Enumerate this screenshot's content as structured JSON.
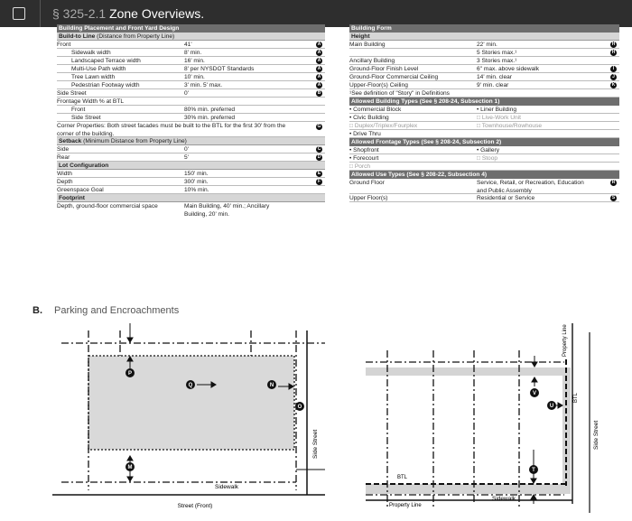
{
  "header": {
    "section": "§ 325-2.1",
    "title": "Zone Overviews."
  },
  "left": {
    "title": "Building Placement and Front Yard Design",
    "btl_head": "Build-to Line",
    "btl_note": "(Distance from Property Line)",
    "front": {
      "label": "Front",
      "value": "41'",
      "badge": "A"
    },
    "front_rows": [
      {
        "label": "Sidewalk width",
        "value": "8' min.",
        "badge": "A"
      },
      {
        "label": "Landscaped Terrace width",
        "value": "16' min.",
        "badge": "A"
      },
      {
        "label": "Multi-Use Path width",
        "value": "8' per NYSDOT Standards",
        "badge": "A"
      },
      {
        "label": "Tree Lawn width",
        "value": "10' min.",
        "badge": "A"
      },
      {
        "label": "Pedestrian Footway width",
        "value": "3' min. 5' max.",
        "badge": "A"
      }
    ],
    "side_street": {
      "label": "Side Street",
      "value": "0'",
      "badge": "B"
    },
    "frontage": {
      "label": "Frontage Width % at BTL"
    },
    "frontage_front": {
      "label": "Front",
      "value": "80% min. preferred"
    },
    "frontage_side": {
      "label": "Side Street",
      "value": "30% min. preferred"
    },
    "corner": {
      "text": "Corner Properties: Both street facades must be built to the BTL for the first 30' from the corner of the building.",
      "badge": "G"
    },
    "setback_head": "Setback",
    "setback_note": "(Minimum Distance from Property Line)",
    "side": {
      "label": "Side",
      "value": "0'",
      "badge": "C"
    },
    "rear": {
      "label": "Rear",
      "value": "5'",
      "badge": "D"
    },
    "lot_head": "Lot Configuration",
    "width": {
      "label": "Width",
      "value": "150' min.",
      "badge": "E"
    },
    "depth": {
      "label": "Depth",
      "value": "300' min.",
      "badge": "F"
    },
    "green": {
      "label": "Greenspace Goal",
      "value": "10% min."
    },
    "foot_head": "Footprint",
    "foot": {
      "label": "Depth, ground-floor commercial space",
      "value": "Main Building, 40' min.; Ancillary Building, 20' min."
    }
  },
  "right": {
    "title": "Building Form",
    "height_head": "Height",
    "main_building": {
      "label": "Main Building",
      "value": "22' min.",
      "badge": "H"
    },
    "main_building2": {
      "value": "5 Stories max.¹",
      "badge": "H"
    },
    "ancillary": {
      "label": "Ancillary Building",
      "value": "3 Stories max.¹"
    },
    "gf_finish": {
      "label": "Ground-Floor Finish Level",
      "value": "6\" max. above sidewalk",
      "badge": "I"
    },
    "gf_ceiling": {
      "label": "Ground-Floor Commercial Ceiling",
      "value": "14' min. clear",
      "badge": "J"
    },
    "uf_ceiling": {
      "label": "Upper-Floor(s) Ceiling",
      "value": "9' min. clear",
      "badge": "K"
    },
    "footnote": "¹See definition of \"Story\" in Definitions",
    "types_head": "Allowed Building Types (See § 208-24, Subsection 1)",
    "types": [
      [
        "• Commercial Block",
        "• Liner Building"
      ],
      [
        "• Civic Building",
        "□ Live-Work Unit"
      ],
      [
        "□ Duplex/Triplex/Fourplex",
        "□ Townhouse/Rowhouse"
      ],
      [
        "• Drive Thru",
        ""
      ]
    ],
    "frontage_head": "Allowed Frontage Types (See § 208-24, Subsection 2)",
    "frontage": [
      [
        "• Shopfront",
        "• Gallery"
      ],
      [
        "• Forecourt",
        "□ Stoop"
      ],
      [
        "□ Porch",
        ""
      ]
    ],
    "use_head": "Allowed Use Types (See § 208-22, Subsection 4)",
    "ground": {
      "label": "Ground Floor",
      "value": "Service, Retail, or Recreation, Education and Public Assembly",
      "badge": "R"
    },
    "upper": {
      "label": "Upper Floor(s)",
      "value": "Residential or Service",
      "badge": "S"
    }
  },
  "sectionB": {
    "letter": "B.",
    "title": "Parking and Encroachments"
  },
  "diagram_left": {
    "street": "Street (Front)",
    "sidewalk": "Sidewalk",
    "side_street": "Side Street",
    "markers": [
      "P",
      "Q",
      "N",
      "O",
      "M"
    ]
  },
  "diagram_right": {
    "property_line_top": "Property Line",
    "btl_right": "BTL",
    "side_street": "Side Street",
    "btl_bottom": "BTL",
    "property_line_bottom": "Property Line",
    "sidewalk": "Sidewalk",
    "markers": [
      "V",
      "U",
      "T"
    ]
  }
}
